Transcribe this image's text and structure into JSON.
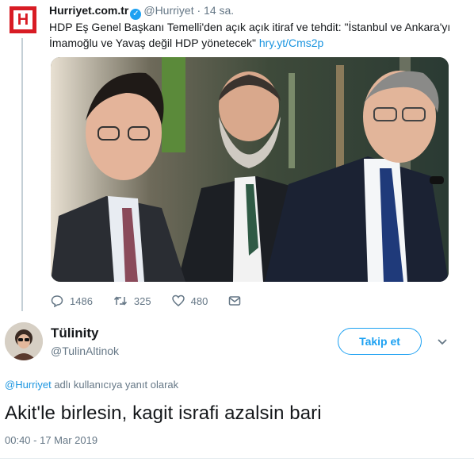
{
  "parent_tweet": {
    "display_name": "Hurriyet.com.tr",
    "handle": "@Hurriyet",
    "separator": "·",
    "time": "14 sa.",
    "text": "HDP Eş Genel Başkanı Temelli'den açık açık itiraf ve tehdit: \"İstanbul ve Ankara'yı İmamoğlu ve Yavaş değil HDP yönetecek\"",
    "link": "hry.yt/Cms2p",
    "logo_letter": "H",
    "photo_icon": "news-photo-three-politicians",
    "replies": "1486",
    "retweets": "325",
    "likes": "480",
    "icons": [
      "reply-icon",
      "retweet-icon",
      "like-icon",
      "message-icon"
    ]
  },
  "reply_tweet": {
    "display_name": "Tülinity",
    "handle": "@TulinAltinok",
    "follow_label": "Takip et",
    "reply_to_mention": "@Hurriyet",
    "reply_to_text": "adlı kullanıcıya yanıt olarak",
    "text": "Akit'le birlesin, kagit israfi azalsin bari",
    "timestamp": "00:40 - 17 Mar 2019"
  },
  "colors": {
    "accent": "#1da1f2",
    "link": "#1b95e0",
    "muted": "#657786",
    "brand_red": "#d81c24"
  }
}
